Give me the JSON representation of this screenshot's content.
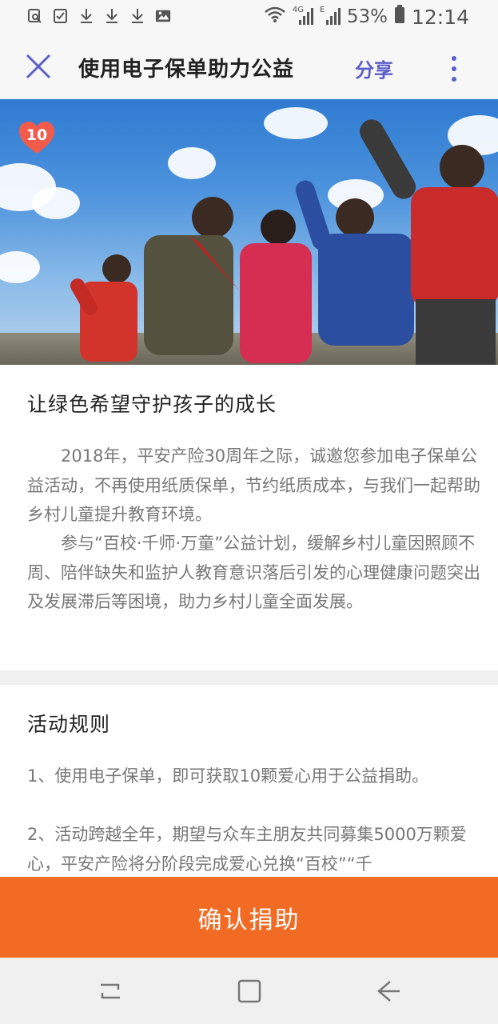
{
  "status_bar": {
    "battery_percent": "53%",
    "time": "12:14",
    "network_label_4g": "4G",
    "network_label_e": "E",
    "icons": [
      "screen-search-icon",
      "checkbox-icon",
      "download-icon",
      "download-icon",
      "download-icon",
      "image-icon",
      "wifi-icon",
      "signal-icon",
      "signal-icon",
      "battery-icon"
    ]
  },
  "app_bar": {
    "title": "使用电子保单助力公益",
    "share_label": "分享",
    "close_icon": "close-icon",
    "more_icon": "more-vertical-icon"
  },
  "hero": {
    "badge_count": "10",
    "badge_icon": "heart-icon"
  },
  "intro": {
    "title": "让绿色希望守护孩子的成长",
    "paragraph1": "　　2018年，平安产险30周年之际，诚邀您参加电子保单公益活动，不再使用纸质保单，节约纸质成本，与我们一起帮助乡村儿童提升教育环境。",
    "paragraph2": "　　参与“百校·千师·万童”公益计划，缓解乡村儿童因照顾不周、陪伴缺失和监护人教育意识落后引发的心理健康问题突出及发展滞后等困境，助力乡村儿童全面发展。"
  },
  "rules": {
    "title": "活动规则",
    "item1": "1、使用电子保单，即可获取10颗爱心用于公益捐助。",
    "item2": "2、活动跨越全年，期望与众车主朋友共同募集5000万颗爱心，平安产险将分阶段完成爱心兑换“百校”“千"
  },
  "confirm_button": {
    "label": "确认捐助"
  },
  "nav_bar": {
    "icons": [
      "recent-apps-icon",
      "home-icon",
      "back-icon"
    ]
  },
  "colors": {
    "accent": "#5b5fc7",
    "button": "#f26b24",
    "badge": "#f25a4a"
  }
}
